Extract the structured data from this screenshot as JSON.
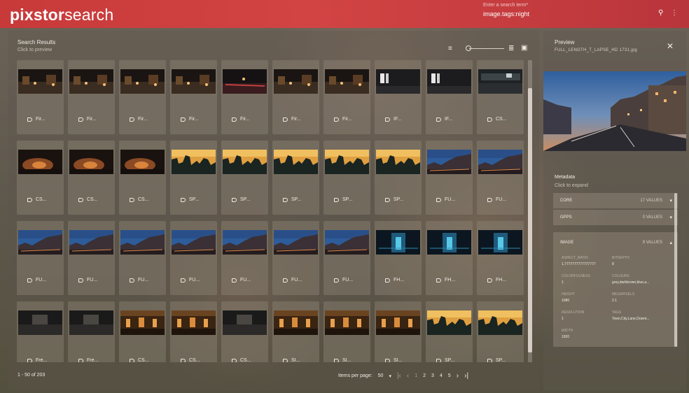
{
  "header": {
    "logo_bold": "pixstor",
    "logo_light": "search",
    "search_label": "Enter a search term*",
    "search_value": "image.tags:night",
    "search_icon": "search-icon",
    "menu_icon": "more-vert-icon"
  },
  "results": {
    "title": "Search Results",
    "subtitle": "Click to preview",
    "range_text": "1 - 50 of 203",
    "items_per_page_label": "Items per page:",
    "items_per_page_value": "50",
    "pages": [
      "1",
      "2",
      "3",
      "4",
      "5"
    ],
    "cards": [
      {
        "label": "Fir..."
      },
      {
        "label": "Fir..."
      },
      {
        "label": "Fir..."
      },
      {
        "label": "Fir..."
      },
      {
        "label": "Fir..."
      },
      {
        "label": "Fir..."
      },
      {
        "label": "Fir..."
      },
      {
        "label": "IF..."
      },
      {
        "label": "IF..."
      },
      {
        "label": "CS..."
      },
      {
        "label": "CS..."
      },
      {
        "label": "CS..."
      },
      {
        "label": "CS..."
      },
      {
        "label": "SP..."
      },
      {
        "label": "SP..."
      },
      {
        "label": "SP..."
      },
      {
        "label": "SP..."
      },
      {
        "label": "SP..."
      },
      {
        "label": "FU..."
      },
      {
        "label": "FU..."
      },
      {
        "label": "FU..."
      },
      {
        "label": "FU..."
      },
      {
        "label": "FU..."
      },
      {
        "label": "FU..."
      },
      {
        "label": "FU..."
      },
      {
        "label": "FU..."
      },
      {
        "label": "FU..."
      },
      {
        "label": "FH..."
      },
      {
        "label": "FH..."
      },
      {
        "label": "FH..."
      },
      {
        "label": "Fre..."
      },
      {
        "label": "Fre..."
      },
      {
        "label": "CS..."
      },
      {
        "label": "CS..."
      },
      {
        "label": "CS..."
      },
      {
        "label": "SI..."
      },
      {
        "label": "SI..."
      },
      {
        "label": "SI..."
      },
      {
        "label": "SP..."
      },
      {
        "label": "SP..."
      }
    ],
    "thumb_styles": [
      "street",
      "street",
      "street",
      "street",
      "redlights",
      "street",
      "street",
      "window",
      "window",
      "office",
      "fire",
      "fire",
      "fire",
      "silhouette",
      "silhouette",
      "silhouette",
      "silhouette",
      "silhouette",
      "dusk",
      "dusk",
      "dusk",
      "dusk",
      "dusk",
      "dusk",
      "dusk",
      "dusk",
      "dusk",
      "blue",
      "blue",
      "blue",
      "dark",
      "dark",
      "orange",
      "orange",
      "dark",
      "orange",
      "orange",
      "orange",
      "silhouette",
      "silhouette"
    ]
  },
  "preview": {
    "title": "Preview",
    "filename": "FULL_LENGTH_T_LAPSE_HD 1731.jpg",
    "metadata_title": "Metadata",
    "metadata_subtitle": "Click to expand",
    "sections": [
      {
        "name": "CORE",
        "count": "17 VALUES",
        "expanded": false
      },
      {
        "name": "GPPS",
        "count": "0 VALUES",
        "expanded": false
      },
      {
        "name": "IMAGE",
        "count": "9 VALUES",
        "expanded": true
      }
    ],
    "image_fields": [
      {
        "label": "ASPECT_RATIO",
        "value": "1.7777777777777777"
      },
      {
        "label": "BITDEPTH",
        "value": "8"
      },
      {
        "label": "COLORFULNESS",
        "value": "1"
      },
      {
        "label": "COLOURS",
        "value": "grey,darkbrown,blue,a..."
      },
      {
        "label": "HEIGHT",
        "value": "1080"
      },
      {
        "label": "MEGAPIXELS",
        "value": "2.1"
      },
      {
        "label": "RESOLUTION",
        "value": "1"
      },
      {
        "label": "TAGS",
        "value": "Town,City,Lane,Downt..."
      },
      {
        "label": "WIDTH",
        "value": "1920"
      }
    ]
  },
  "colors": {
    "header": "#d24444",
    "panel": "#6c6358"
  }
}
